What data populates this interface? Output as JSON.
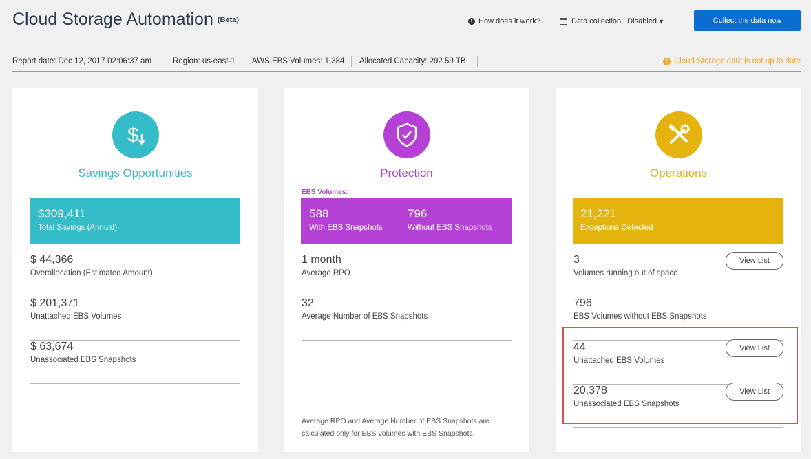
{
  "header": {
    "title": "Cloud Storage Automation",
    "beta": "(Beta)",
    "help_link": "How does it work?",
    "data_collection_label": "Data collection:",
    "data_collection_value": "Disabled",
    "collect_button": "Collect the data now"
  },
  "report": {
    "date": "Report date: Dec 12, 2017 02:06:37 am",
    "region": "Region: us-east-1",
    "volumes": "AWS EBS Volumes: 1,384",
    "capacity": "Allocated Capacity: 292.59 TB",
    "warning": "Cloud Storage data is not up to date"
  },
  "savings": {
    "title": "Savings Opportunities",
    "hero_value": "$309,411",
    "hero_label": "Total Savings (Annual)",
    "rows": [
      {
        "value": "$ 44,366",
        "label": "Overallocation (Estimated Amount)"
      },
      {
        "value": "$ 201,371",
        "label": "Unattached EBS Volumes"
      },
      {
        "value": "$ 63,674",
        "label": "Unassociated EBS Snapshots"
      }
    ]
  },
  "protection": {
    "title": "Protection",
    "ebs_label": "EBS Volumes:",
    "with_value": "588",
    "with_label": "With EBS Snapshots",
    "without_value": "796",
    "without_label": "Without EBS Snapshots",
    "rows": [
      {
        "value": "1 month",
        "label": "Average RPO"
      },
      {
        "value": "32",
        "label": "Average Number of EBS Snapshots"
      }
    ],
    "footnote": "Average RPO and Average Number of EBS Snapshots are calculated only for EBS volumes with EBS Snapshots."
  },
  "operations": {
    "title": "Operations",
    "hero_value": "21,221",
    "hero_label": "Exceptions Detected",
    "view_list": "View List",
    "rows": [
      {
        "value": "3",
        "label": "Volumes running out of space"
      },
      {
        "value": "796",
        "label": "EBS Volumes without EBS Snapshots"
      },
      {
        "value": "44",
        "label": "Unattached EBS Volumes"
      },
      {
        "value": "20,378",
        "label": "Unassociated EBS Snapshots"
      }
    ]
  },
  "colors": {
    "savings": "#35bcc9",
    "protection": "#b540d6",
    "operations": "#e5b30e",
    "primary_button": "#0a6dd1",
    "warning": "#f5a623",
    "highlight": "#d9534f"
  },
  "icons": {
    "savings": "dollar-down-icon",
    "protection": "shield-check-icon",
    "operations": "tools-icon"
  }
}
